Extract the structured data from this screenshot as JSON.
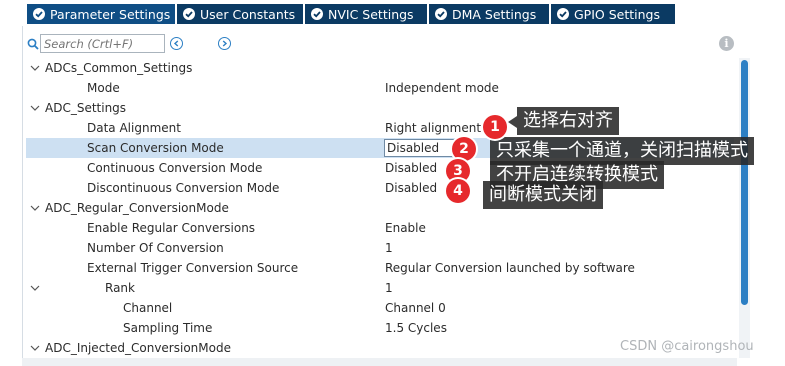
{
  "tabs": [
    {
      "label": "Parameter Settings",
      "active": true
    },
    {
      "label": "User Constants",
      "active": false
    },
    {
      "label": "NVIC Settings",
      "active": false
    },
    {
      "label": "DMA Settings",
      "active": false
    },
    {
      "label": "GPIO Settings",
      "active": false
    }
  ],
  "search": {
    "placeholder": "Search (Crtl+F)"
  },
  "tree": [
    {
      "label": "ADCs_Common_Settings",
      "value": "",
      "expander": "down",
      "level": 0
    },
    {
      "label": "Mode",
      "value": "Independent mode",
      "level": 1
    },
    {
      "label": "ADC_Settings",
      "value": "",
      "expander": "down",
      "level": 0
    },
    {
      "label": "Data Alignment",
      "value": "Right alignment",
      "level": 1
    },
    {
      "label": "Scan Conversion Mode",
      "value": "Disabled",
      "level": 1,
      "selected": true
    },
    {
      "label": "Continuous Conversion Mode",
      "value": "Disabled",
      "level": 1
    },
    {
      "label": "Discontinuous Conversion Mode",
      "value": "Disabled",
      "level": 1
    },
    {
      "label": "ADC_Regular_ConversionMode",
      "value": "",
      "expander": "down",
      "level": 0
    },
    {
      "label": "Enable Regular Conversions",
      "value": "Enable",
      "level": 1
    },
    {
      "label": "Number Of Conversion",
      "value": "1",
      "level": 1
    },
    {
      "label": "External Trigger Conversion Source",
      "value": "Regular Conversion launched by software",
      "level": 1
    },
    {
      "label": "Rank",
      "value": "1",
      "expander": "down",
      "level": 1
    },
    {
      "label": "Channel",
      "value": "Channel 0",
      "level": 2
    },
    {
      "label": "Sampling Time",
      "value": "1.5 Cycles",
      "level": 2
    },
    {
      "label": "ADC_Injected_ConversionMode",
      "value": "",
      "expander": "down",
      "level": 0
    }
  ],
  "annotations": [
    {
      "number": "1",
      "text": "选择右对齐"
    },
    {
      "number": "2",
      "text": "只采集一个通道，关闭扫描模式"
    },
    {
      "number": "3",
      "text": "不开启连续转换模式"
    },
    {
      "number": "4",
      "text": "间断模式关闭"
    }
  ],
  "watermark": "CSDN @cairongshou",
  "colors": {
    "tab_bg": "#0b3a63",
    "tab_active": "#0f4e85",
    "selection": "#cde0f2",
    "accent": "#2c7fc4",
    "badge": "#e6292c"
  }
}
